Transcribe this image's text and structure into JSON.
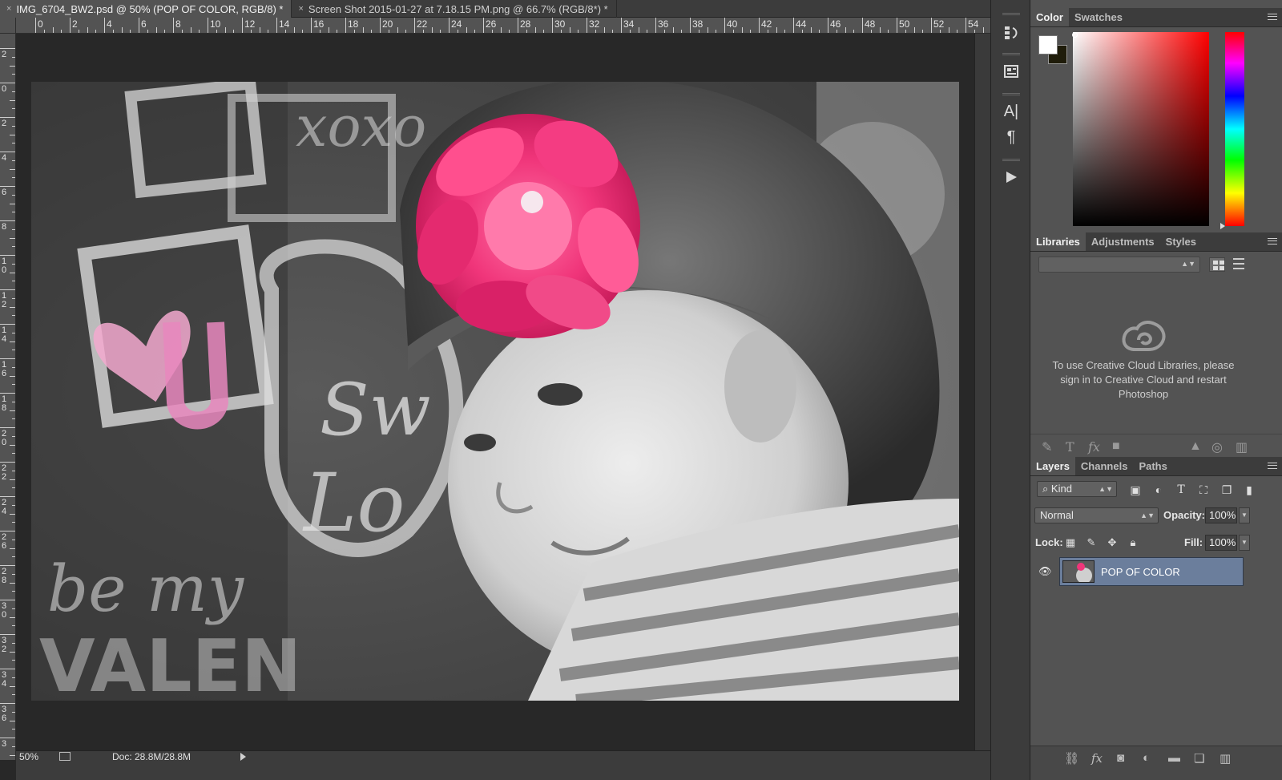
{
  "document_tabs": [
    {
      "title": "IMG_6704_BW2.psd @ 50% (POP OF COLOR, RGB/8) *",
      "active": true
    },
    {
      "title": "Screen Shot 2015-01-27 at 7.18.15 PM.png @ 66.7% (RGB/8*) *",
      "active": false
    }
  ],
  "close_glyph": "×",
  "ruler_top": [
    "0",
    "2",
    "4",
    "6",
    "8",
    "10",
    "12",
    "14",
    "16",
    "18",
    "20",
    "22",
    "24",
    "26",
    "28",
    "30",
    "32",
    "34",
    "36",
    "38",
    "40",
    "42",
    "44",
    "46",
    "48",
    "50",
    "52",
    "54"
  ],
  "ruler_left": [
    "2",
    "0",
    "2",
    "4",
    "6",
    "8",
    "10",
    "12",
    "14",
    "16",
    "18",
    "20",
    "22",
    "24",
    "26",
    "28",
    "30",
    "32",
    "34",
    "36",
    "3"
  ],
  "status": {
    "zoom": "50%",
    "doc_info": "Doc: 28.8M/28.8M"
  },
  "dock": {
    "icons": [
      "history-icon",
      "properties-icon",
      "character-icon",
      "paragraph-icon",
      "actions-play-icon"
    ],
    "character_glyph": "A|",
    "paragraph_glyph": "¶"
  },
  "color_panel": {
    "tabs": [
      "Color",
      "Swatches"
    ],
    "foreground": "#ffffff",
    "background": "#1f1c0a",
    "field_hue": "#ff0000"
  },
  "libraries_panel": {
    "tabs": [
      "Libraries",
      "Adjustments",
      "Styles"
    ],
    "message": "To use Creative Cloud Libraries, please sign in to Creative Cloud and restart Photoshop"
  },
  "layers_panel": {
    "tabs": [
      "Layers",
      "Channels",
      "Paths"
    ],
    "filter_kind": "Kind",
    "blend_mode": "Normal",
    "opacity_label": "Opacity:",
    "opacity_value": "100%",
    "lock_label": "Lock:",
    "fill_label": "Fill:",
    "fill_value": "100%",
    "layers": [
      {
        "name": "POP OF COLOR",
        "visible": true,
        "selected": true
      }
    ],
    "selection_color": "#6b7e9c"
  },
  "colors": {
    "accent_pink": "#f0357a",
    "panel_bg": "#535353",
    "chrome_bg": "#3c3c3c"
  }
}
